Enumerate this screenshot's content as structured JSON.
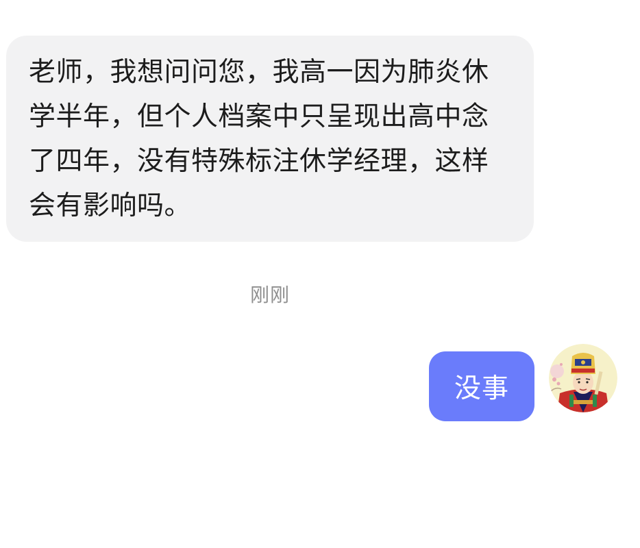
{
  "messages": {
    "incoming": {
      "text": "老师，我想问问您，我高一因为肺炎休学半年，但个人档案中只呈现出高中念了四年，没有特殊标注休学经理，这样会有影响吗。"
    },
    "timestamp": "刚刚",
    "outgoing": {
      "text": "没事"
    }
  },
  "avatar": {
    "icon": "cartoon-official-avatar-icon"
  },
  "colors": {
    "incoming_bubble": "#f2f2f3",
    "outgoing_bubble": "#6a7cfb",
    "timestamp_text": "#8e8e8e"
  }
}
